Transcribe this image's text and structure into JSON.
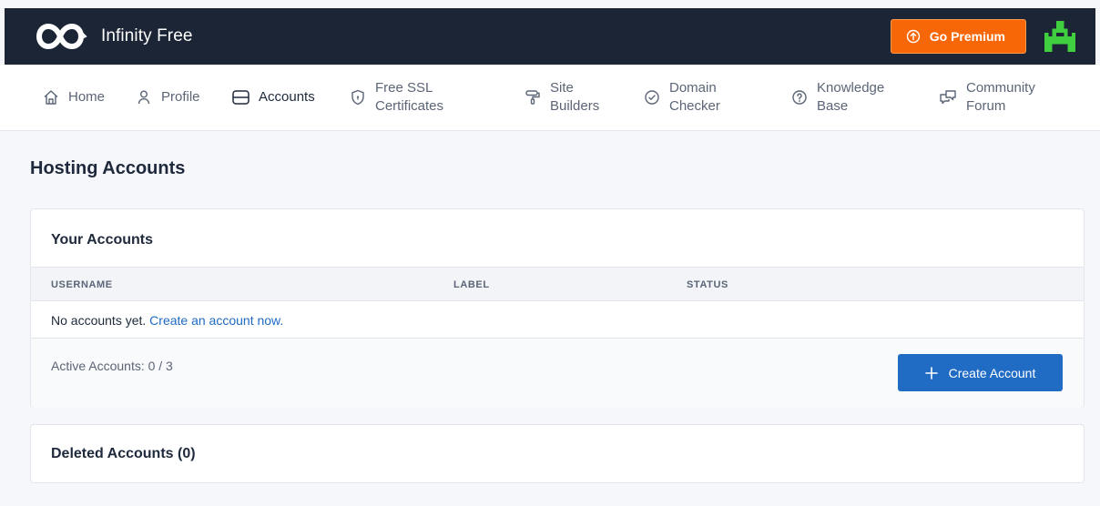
{
  "brand": {
    "name": "Infinity Free"
  },
  "header": {
    "premium_label": "Go Premium"
  },
  "nav": {
    "home": "Home",
    "profile": "Profile",
    "accounts": "Accounts",
    "ssl_line1": "Free SSL",
    "ssl_line2": "Certificates",
    "builders_line1": "Site",
    "builders_line2": "Builders",
    "domain_line1": "Domain",
    "domain_line2": "Checker",
    "kb_line1": "Knowledge",
    "kb_line2": "Base",
    "forum_line1": "Community",
    "forum_line2": "Forum"
  },
  "page": {
    "title": "Hosting Accounts"
  },
  "accounts_card": {
    "title": "Your Accounts",
    "columns": [
      "USERNAME",
      "LABEL",
      "STATUS"
    ],
    "empty_text": "No accounts yet.",
    "empty_link": "Create an account now.",
    "active_count": "Active Accounts: 0 / 3",
    "create_label": "Create Account"
  },
  "deleted_card": {
    "title": "Deleted Accounts (0)"
  },
  "colors": {
    "header_bg": "#1c2536",
    "premium": "#f76707",
    "primary": "#206bc4",
    "link": "#206bc4",
    "avatar_green": "#3fcf3f"
  },
  "icons": {
    "logo": "infinity-logo-icon",
    "premium": "arrow-up-circle-icon",
    "home": "home-icon",
    "profile": "user-icon",
    "accounts": "server-icon",
    "ssl": "shield-icon",
    "builders": "paint-roller-icon",
    "domain": "check-circle-icon",
    "kb": "help-circle-icon",
    "forum": "messages-icon",
    "create": "plus-icon"
  }
}
